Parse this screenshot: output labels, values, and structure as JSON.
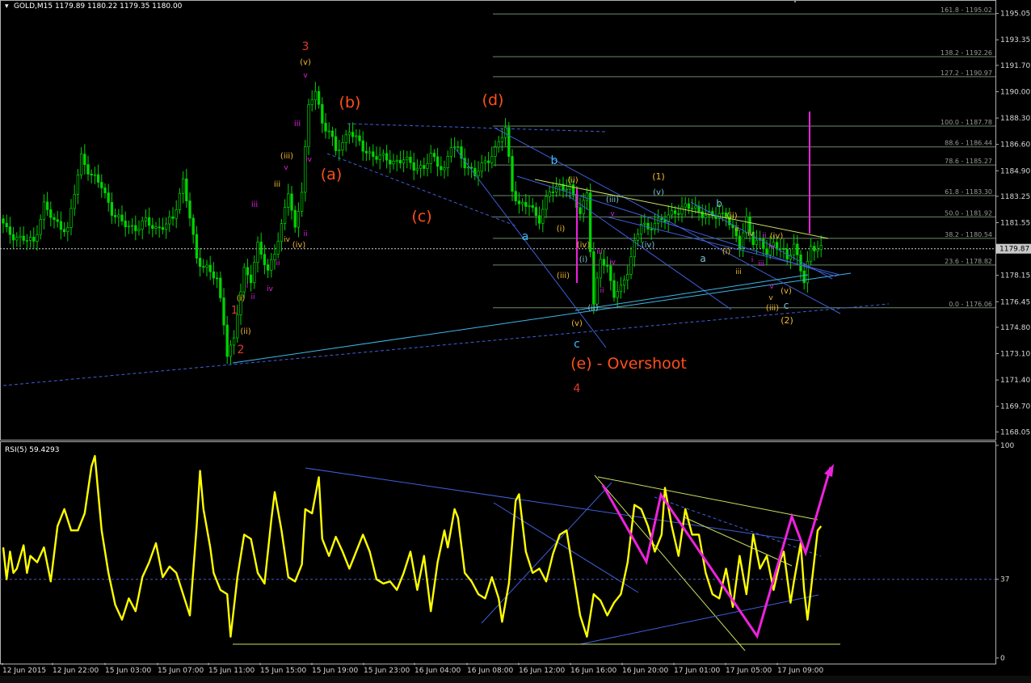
{
  "window": {
    "symbol_label": "GOLD,M15",
    "ohlc_label": "1179.89 1180.22 1179.35 1180.00",
    "current_price_label": "1179.87"
  },
  "colors": {
    "background": "#000000",
    "candles": "#00d400",
    "rsi_line": "#ffff00",
    "frame": "#b0b0b0",
    "bid_line": "#cfcfcf",
    "trend_blue": "#3f5fd8",
    "trend_cyan": "#3fb8e8",
    "trend_yellowgreen": "#c8e060",
    "fib_lines": "#6e8a6e",
    "wave_orange": "#ff4f1a",
    "wave_red": "#e23b2a",
    "wave_gold": "#f2b92e",
    "wave_magenta": "#e020e0",
    "wave_blue": "#3fb8ff",
    "wave_teal": "#79c3d0",
    "projection": "#ee22dd"
  },
  "chart_data": [
    {
      "type": "candlestick",
      "title": "GOLD,M15",
      "subtitle": "1179.89 1180.22 1179.35 1180.00",
      "ylim": [
        1167.6,
        1195.5
      ],
      "y_ticks": [
        "1195.05",
        "1193.35",
        "1191.70",
        "1190.00",
        "1188.30",
        "1186.60",
        "1184.90",
        "1183.25",
        "1181.55",
        "1179.87",
        "1178.15",
        "1176.45",
        "1174.80",
        "1173.10",
        "1171.40",
        "1169.70",
        "1168.05"
      ],
      "x_ticks": [
        "12 Jun 2015",
        "12 Jun 22:00",
        "15 Jun 03:00",
        "15 Jun 07:00",
        "15 Jun 11:00",
        "15 Jun 15:00",
        "15 Jun 19:00",
        "15 Jun 23:00",
        "16 Jun 04:00",
        "16 Jun 08:00",
        "16 Jun 12:00",
        "16 Jun 16:00",
        "16 Jun 20:00",
        "17 Jun 01:00",
        "17 Jun 05:00",
        "17 Jun 09:00"
      ],
      "price_path": [
        [
          0,
          1181.8
        ],
        [
          2,
          1181.0
        ],
        [
          5,
          1180.6
        ],
        [
          10,
          1180.3
        ],
        [
          13,
          1182.7
        ],
        [
          16,
          1181.6
        ],
        [
          20,
          1181.1
        ],
        [
          24,
          1185.8
        ],
        [
          27,
          1184.6
        ],
        [
          30,
          1183.9
        ],
        [
          33,
          1182.3
        ],
        [
          36,
          1181.5
        ],
        [
          40,
          1181.2
        ],
        [
          43,
          1181.6
        ],
        [
          46,
          1181.2
        ],
        [
          49,
          1181.4
        ],
        [
          51,
          1181.8
        ],
        [
          54,
          1184.3
        ],
        [
          56,
          1181.9
        ],
        [
          58,
          1179.1
        ],
        [
          61,
          1178.7
        ],
        [
          64,
          1177.8
        ],
        [
          66,
          1175.1
        ],
        [
          67,
          1173.2
        ],
        [
          69,
          1174.0
        ],
        [
          70,
          1175.7
        ],
        [
          72,
          1178.4
        ],
        [
          74,
          1178.0
        ],
        [
          76,
          1180.1
        ],
        [
          79,
          1178.3
        ],
        [
          81,
          1179.8
        ],
        [
          83,
          1181.3
        ],
        [
          85,
          1183.5
        ],
        [
          87,
          1181.1
        ],
        [
          89,
          1183.8
        ],
        [
          91,
          1188.9
        ],
        [
          93,
          1190.1
        ],
        [
          95,
          1188.0
        ],
        [
          97,
          1187.5
        ],
        [
          99,
          1186.1
        ],
        [
          101,
          1186.7
        ],
        [
          103,
          1187.6
        ],
        [
          105,
          1186.9
        ],
        [
          107,
          1186.3
        ],
        [
          110,
          1185.9
        ],
        [
          113,
          1185.7
        ],
        [
          116,
          1185.5
        ],
        [
          119,
          1185.6
        ],
        [
          122,
          1185.2
        ],
        [
          125,
          1185.1
        ],
        [
          127,
          1185.8
        ],
        [
          129,
          1185.4
        ],
        [
          131,
          1185.0
        ],
        [
          133,
          1186.5
        ],
        [
          135,
          1186.2
        ],
        [
          137,
          1185.4
        ],
        [
          140,
          1184.6
        ],
        [
          143,
          1185.5
        ],
        [
          146,
          1186.2
        ],
        [
          149,
          1187.6
        ],
        [
          151,
          1183.8
        ],
        [
          153,
          1182.6
        ],
        [
          156,
          1182.7
        ],
        [
          159,
          1181.8
        ],
        [
          162,
          1183.5
        ],
        [
          165,
          1184.0
        ],
        [
          168,
          1183.7
        ],
        [
          171,
          1182.2
        ],
        [
          173,
          1183.6
        ],
        [
          175,
          1176.1
        ],
        [
          177,
          1179.3
        ],
        [
          179,
          1178.7
        ],
        [
          181,
          1176.9
        ],
        [
          183,
          1177.2
        ],
        [
          185,
          1178.5
        ],
        [
          187,
          1180.3
        ],
        [
          189,
          1181.5
        ],
        [
          191,
          1181.0
        ],
        [
          193,
          1181.7
        ],
        [
          196,
          1181.7
        ],
        [
          199,
          1182.3
        ],
        [
          202,
          1182.6
        ],
        [
          205,
          1182.4
        ],
        [
          208,
          1182.1
        ],
        [
          211,
          1181.9
        ],
        [
          214,
          1182.2
        ],
        [
          216,
          1181.0
        ],
        [
          218,
          1180.0
        ],
        [
          220,
          1181.8
        ],
        [
          222,
          1180.4
        ],
        [
          224,
          1180.2
        ],
        [
          226,
          1179.6
        ],
        [
          228,
          1180.3
        ],
        [
          230,
          1179.9
        ],
        [
          232,
          1179.1
        ],
        [
          234,
          1180.2
        ],
        [
          236,
          1178.6
        ],
        [
          237,
          1177.8
        ],
        [
          239,
          1179.8
        ],
        [
          241,
          1180.0
        ]
      ],
      "fib_levels": [
        {
          "label": "161.8 - 1195.02",
          "value": 1195.02
        },
        {
          "label": "138.2 - 1192.26",
          "value": 1192.26
        },
        {
          "label": "127.2 - 1190.97",
          "value": 1190.97
        },
        {
          "label": "100.0 - 1187.78",
          "value": 1187.78
        },
        {
          "label": "88.6 - 1186.44",
          "value": 1186.44
        },
        {
          "label": "78.6 - 1185.27",
          "value": 1185.27
        },
        {
          "label": "61.8 - 1183.30",
          "value": 1183.3
        },
        {
          "label": "50.0 - 1181.92",
          "value": 1181.92
        },
        {
          "label": "38.2 - 1180.54",
          "value": 1180.54
        },
        {
          "label": "23.6 - 1178.82",
          "value": 1178.82
        },
        {
          "label": "0.0 - 1176.06",
          "value": 1176.06
        }
      ],
      "annotations": [
        "3",
        "(a)",
        "(b)",
        "(c)",
        "(d)",
        "(e) - Overshoot",
        "4",
        "1",
        "2",
        "a",
        "b",
        "c",
        "(1)",
        "(2)",
        "(i)",
        "(ii)",
        "(iii)",
        "(iv)",
        "(v)",
        "i",
        "ii",
        "iii",
        "iv",
        "v"
      ]
    },
    {
      "type": "line",
      "title": "RSI(5) 59.4293",
      "ylim": [
        0,
        100
      ],
      "y_ticks": [
        "100",
        "37",
        "0"
      ],
      "reference_level": 37,
      "values": [
        [
          0,
          52
        ],
        [
          1,
          37
        ],
        [
          2,
          50
        ],
        [
          3,
          40
        ],
        [
          4,
          42
        ],
        [
          6,
          53
        ],
        [
          7,
          40
        ],
        [
          8,
          48
        ],
        [
          10,
          45
        ],
        [
          12,
          52
        ],
        [
          14,
          36
        ],
        [
          16,
          62
        ],
        [
          18,
          70
        ],
        [
          20,
          60
        ],
        [
          22,
          60
        ],
        [
          24,
          68
        ],
        [
          26,
          90
        ],
        [
          27,
          95
        ],
        [
          29,
          60
        ],
        [
          31,
          40
        ],
        [
          33,
          25
        ],
        [
          35,
          18
        ],
        [
          37,
          28
        ],
        [
          39,
          22
        ],
        [
          41,
          38
        ],
        [
          43,
          45
        ],
        [
          45,
          54
        ],
        [
          47,
          38
        ],
        [
          49,
          43
        ],
        [
          51,
          40
        ],
        [
          53,
          30
        ],
        [
          55,
          20
        ],
        [
          57,
          62
        ],
        [
          58,
          88
        ],
        [
          59,
          70
        ],
        [
          61,
          52
        ],
        [
          62,
          40
        ],
        [
          64,
          32
        ],
        [
          66,
          30
        ],
        [
          67,
          10
        ],
        [
          69,
          38
        ],
        [
          71,
          58
        ],
        [
          73,
          56
        ],
        [
          75,
          40
        ],
        [
          77,
          35
        ],
        [
          79,
          65
        ],
        [
          80,
          78
        ],
        [
          82,
          60
        ],
        [
          84,
          38
        ],
        [
          86,
          36
        ],
        [
          88,
          44
        ],
        [
          89,
          70
        ],
        [
          91,
          68
        ],
        [
          93,
          85
        ],
        [
          94,
          56
        ],
        [
          96,
          48
        ],
        [
          98,
          57
        ],
        [
          100,
          50
        ],
        [
          102,
          42
        ],
        [
          104,
          50
        ],
        [
          106,
          58
        ],
        [
          108,
          50
        ],
        [
          110,
          37
        ],
        [
          112,
          35
        ],
        [
          114,
          36
        ],
        [
          116,
          32
        ],
        [
          118,
          40
        ],
        [
          120,
          50
        ],
        [
          122,
          32
        ],
        [
          124,
          48
        ],
        [
          126,
          22
        ],
        [
          128,
          45
        ],
        [
          130,
          60
        ],
        [
          131,
          52
        ],
        [
          133,
          70
        ],
        [
          134,
          66
        ],
        [
          136,
          40
        ],
        [
          138,
          36
        ],
        [
          140,
          30
        ],
        [
          142,
          28
        ],
        [
          144,
          38
        ],
        [
          146,
          28
        ],
        [
          147,
          17
        ],
        [
          149,
          35
        ],
        [
          151,
          74
        ],
        [
          152,
          77
        ],
        [
          154,
          50
        ],
        [
          156,
          40
        ],
        [
          158,
          42
        ],
        [
          160,
          36
        ],
        [
          162,
          49
        ],
        [
          164,
          58
        ],
        [
          166,
          60
        ],
        [
          168,
          40
        ],
        [
          170,
          20
        ],
        [
          172,
          10
        ],
        [
          174,
          30
        ],
        [
          176,
          27
        ],
        [
          178,
          20
        ],
        [
          180,
          26
        ],
        [
          182,
          30
        ],
        [
          184,
          45
        ],
        [
          186,
          72
        ],
        [
          188,
          70
        ],
        [
          190,
          62
        ],
        [
          192,
          50
        ],
        [
          194,
          58
        ],
        [
          195,
          80
        ],
        [
          197,
          62
        ],
        [
          199,
          48
        ],
        [
          201,
          70
        ],
        [
          203,
          58
        ],
        [
          205,
          58
        ],
        [
          207,
          40
        ],
        [
          209,
          30
        ],
        [
          211,
          28
        ],
        [
          213,
          42
        ],
        [
          215,
          24
        ],
        [
          217,
          48
        ],
        [
          219,
          30
        ],
        [
          221,
          58
        ],
        [
          223,
          42
        ],
        [
          225,
          48
        ],
        [
          227,
          32
        ],
        [
          229,
          46
        ],
        [
          230,
          50
        ],
        [
          232,
          26
        ],
        [
          233,
          36
        ],
        [
          235,
          54
        ],
        [
          236,
          32
        ],
        [
          237,
          18
        ],
        [
          239,
          46
        ],
        [
          240,
          60
        ],
        [
          241,
          62
        ]
      ]
    }
  ]
}
